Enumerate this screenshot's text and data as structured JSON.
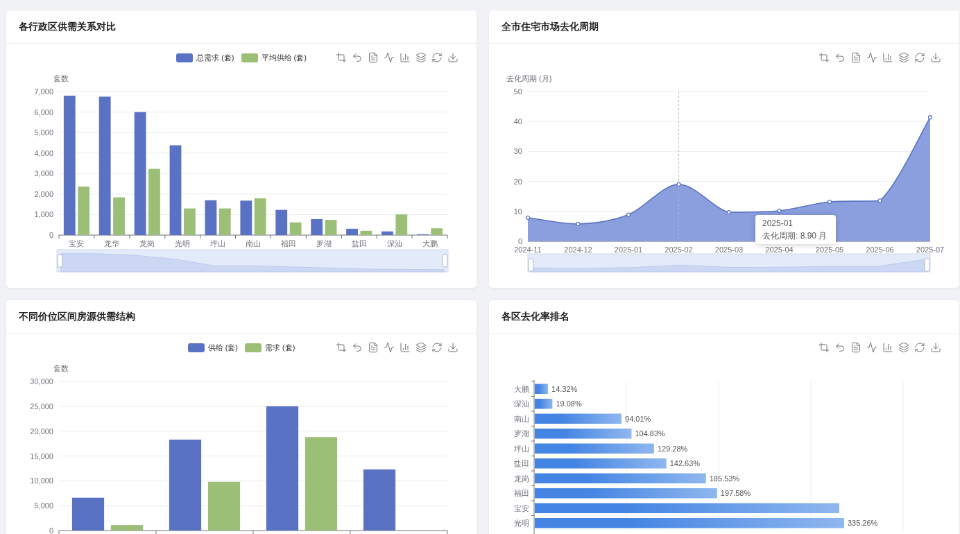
{
  "panels": [
    {
      "title": "各行政区供需关系对比",
      "chart_data": {
        "type": "bar",
        "ylabel": "套数",
        "categories": [
          "宝安",
          "龙华",
          "龙岗",
          "光明",
          "坪山",
          "南山",
          "福田",
          "罗湖",
          "盐田",
          "深汕",
          "大鹏"
        ],
        "series": [
          {
            "name": "总需求 (套)",
            "color": "#5a72c3",
            "values": [
              6800,
              6750,
              6000,
              4380,
              1700,
              1680,
              1230,
              780,
              310,
              180,
              40
            ]
          },
          {
            "name": "平均供给 (套)",
            "color": "#9bbf76",
            "values": [
              2370,
              1840,
              3230,
              1300,
              1300,
              1790,
              620,
              740,
              210,
              1010,
              330
            ]
          }
        ],
        "ylim": [
          0,
          7000
        ],
        "grid": true,
        "yticks": [
          0,
          {
            "value": 1000,
            "label": "1,000"
          },
          {
            "value": 2000,
            "label": "2,000"
          },
          {
            "value": 3000,
            "label": "3,000"
          },
          {
            "value": 4000,
            "label": "4,000"
          },
          {
            "value": 5000,
            "label": "5,000"
          },
          {
            "value": 6000,
            "label": "6,000"
          },
          {
            "value": 7000,
            "label": "7,000"
          }
        ]
      }
    },
    {
      "title": "全市住宅市场去化周期",
      "chart_data": {
        "type": "area",
        "ylabel": "去化周期 (月)",
        "x": [
          "2024-11",
          "2024-12",
          "2025-01",
          "2025-02",
          "2025-03",
          "2025-04",
          "2025-05",
          "2025-06",
          "2025-07"
        ],
        "series": [
          {
            "color": "#5a72c3",
            "values": [
              7.9,
              5.8,
              8.9,
              19.0,
              9.7,
              10.2,
              13.2,
              13.6,
              41.4
            ]
          }
        ],
        "ylim": [
          0,
          50
        ],
        "grid": true,
        "ref_lines": [
          {
            "axis": "x",
            "value": "2025-02"
          }
        ],
        "yticks": [
          0,
          10,
          20,
          30,
          40,
          50
        ]
      },
      "tooltip": {
        "title": "2025-01",
        "line": "去化周期: 8.90 月"
      }
    },
    {
      "title": "不同价位区间房源供需结构",
      "chart_data": {
        "type": "bar",
        "ylabel": "套数",
        "series": [
          {
            "name": "供给 (套)",
            "color": "#5a72c3",
            "values": [
              6600,
              18300,
              25000,
              12300
            ]
          },
          {
            "name": "需求 (套)",
            "color": "#9bbf76",
            "values": [
              1100,
              9800,
              18800,
              null
            ]
          }
        ],
        "ylim": [
          0,
          30000
        ],
        "grid": true,
        "yticks": [
          0,
          {
            "value": 5000,
            "label": "5,000"
          },
          {
            "value": 10000,
            "label": "10,000"
          },
          {
            "value": 15000,
            "label": "15,000"
          },
          {
            "value": 20000,
            "label": "20,000"
          },
          {
            "value": 25000,
            "label": "25,000"
          },
          {
            "value": 30000,
            "label": "30,000"
          }
        ]
      }
    },
    {
      "title": "各区去化率排名",
      "chart_data": {
        "type": "bar",
        "orientation": "horizontal",
        "categories": [
          "大鹏",
          "深汕",
          "南山",
          "罗湖",
          "坪山",
          "盐田",
          "龙岗",
          "福田",
          "宝安",
          "光明"
        ],
        "values": [
          14.32,
          19.08,
          94.01,
          104.83,
          129.28,
          142.63,
          185.53,
          197.58,
          330,
          335.26
        ],
        "value_labels": [
          "14.32%",
          "19.08%",
          "94.01%",
          "104.83%",
          "129.28%",
          "142.63%",
          "185.53%",
          "197.58%",
          null,
          "335.26%"
        ]
      }
    }
  ]
}
